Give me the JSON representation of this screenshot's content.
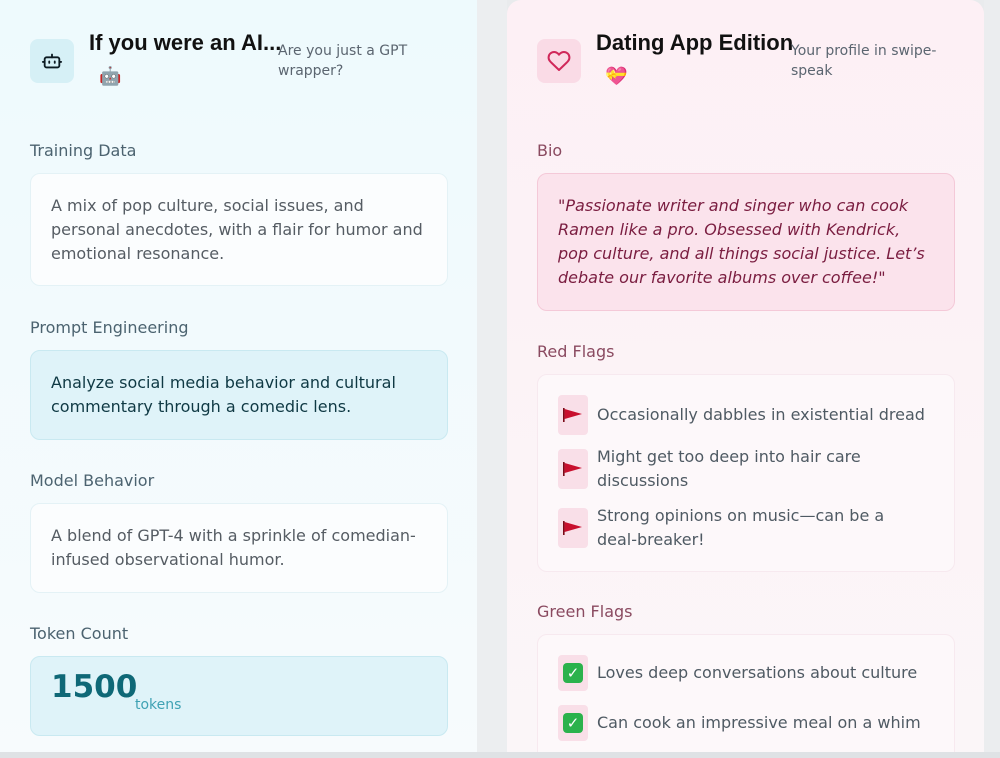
{
  "left_card": {
    "icon": "robot-icon",
    "title": "If you were an AI...",
    "emoji": "🤖",
    "subtitle": "Are you just a GPT wrapper?",
    "training_label": "Training Data",
    "training_text": "A mix of pop culture, social issues, and personal anecdotes, with a flair for humor and emotional resonance.",
    "prompt_label": "Prompt Engineering",
    "prompt_text": "Analyze social media behavior and cultural commentary through a comedic lens.",
    "model_label": "Model Behavior",
    "model_text": "A blend of GPT-4 with a sprinkle of comedian-infused observational humor.",
    "token_label": "Token Count",
    "token_value": "1500",
    "token_unit": "tokens"
  },
  "right_card": {
    "icon": "heart-icon",
    "title": "Dating App Edition",
    "emoji": "💝",
    "subtitle": "Your profile in swipe-speak",
    "bio_label": "Bio",
    "bio_text": "\"Passionate writer and singer who can cook Ramen like a pro. Obsessed with Kendrick, pop culture, and all things social justice. Let’s debate our favorite albums over coffee!\"",
    "red_label": "Red Flags",
    "red_flags": [
      "Occasionally dabbles in existential dread",
      "Might get too deep into hair care discussions",
      "Strong opinions on music—can be a deal-breaker!"
    ],
    "green_label": "Green Flags",
    "green_flags": [
      "Loves deep conversations about culture",
      "Can cook an impressive meal on a whim"
    ]
  },
  "colors": {
    "accent_cyan": "#0f6877",
    "accent_pink": "#7a1d40",
    "red_flag": "#c8102e",
    "green_check": "#2bb24c"
  }
}
